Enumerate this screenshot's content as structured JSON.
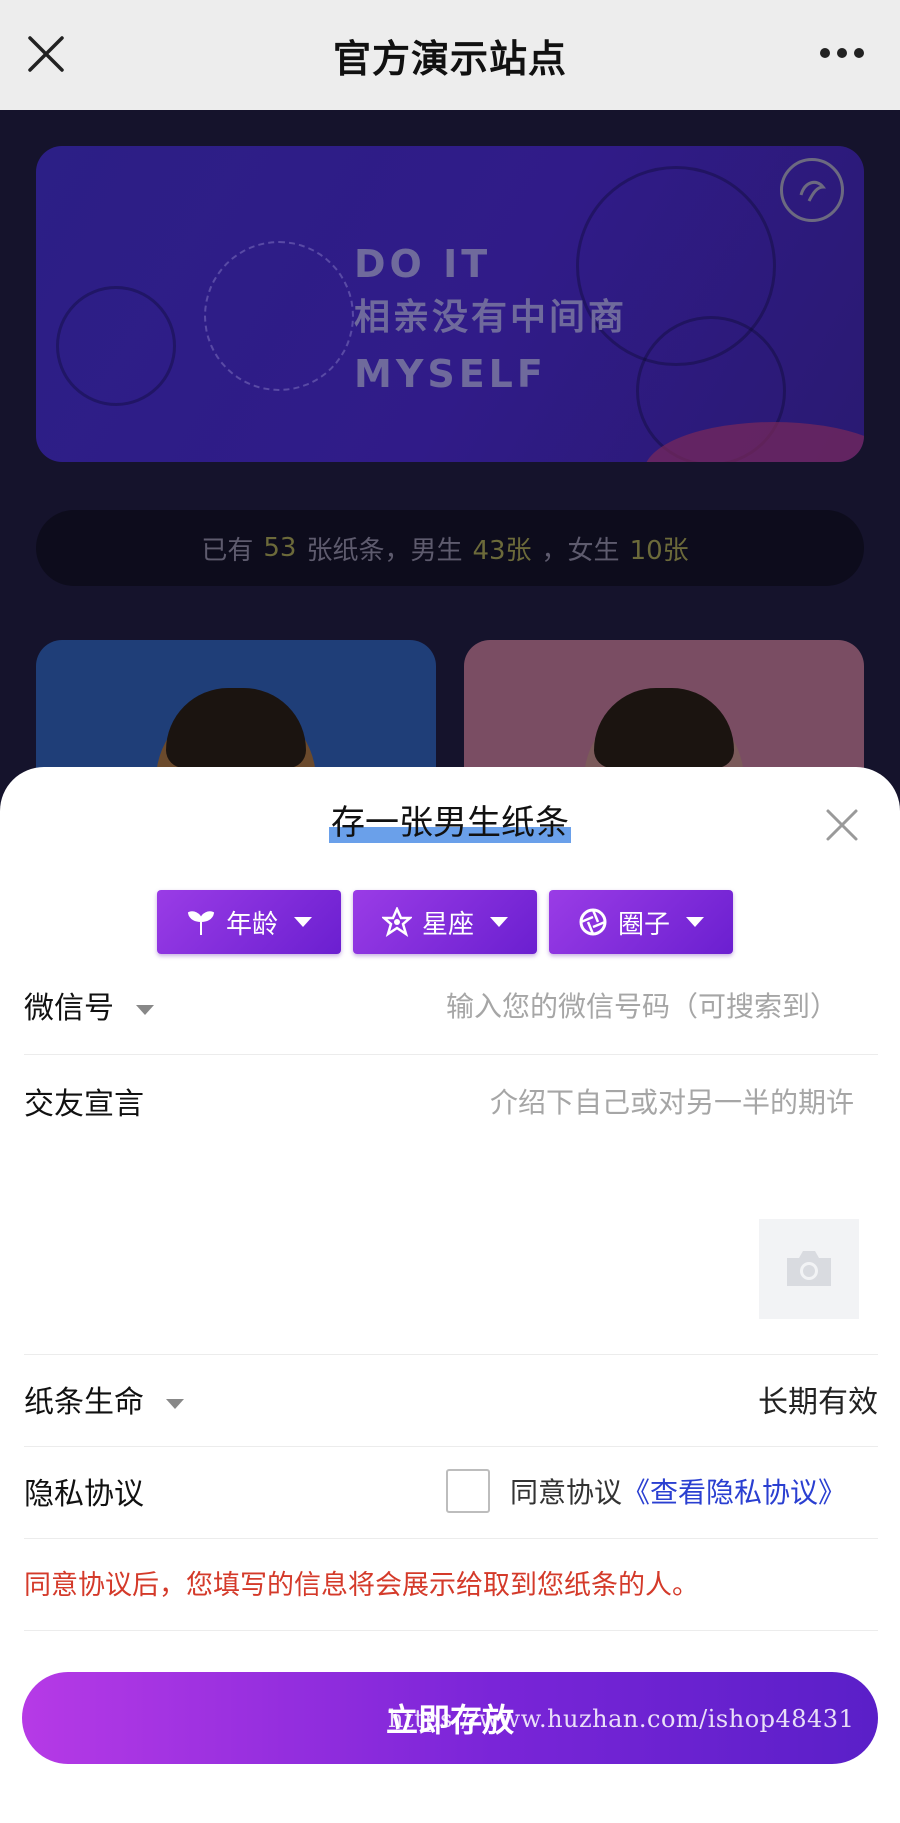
{
  "window": {
    "title": "官方演示站点"
  },
  "banner": {
    "line1": "DO IT",
    "line2": "相亲没有中间商",
    "line3": "MYSELF"
  },
  "stats": {
    "prefix": "已有",
    "total": "53",
    "mid1": "张纸条，男生",
    "male": "43张",
    "mid2": "，女生",
    "female": "10张"
  },
  "sheet": {
    "title": "存一张男生纸条",
    "filters": [
      {
        "label": "年龄",
        "icon": "sprout-icon"
      },
      {
        "label": "星座",
        "icon": "star-icon"
      },
      {
        "label": "圈子",
        "icon": "aperture-icon"
      }
    ],
    "wechat": {
      "label": "微信号",
      "placeholder": "输入您的微信号码（可搜索到）"
    },
    "manifesto": {
      "label": "交友宣言",
      "placeholder": "介绍下自己或对另一半的期许"
    },
    "lifetime": {
      "label": "纸条生命",
      "value": "长期有效"
    },
    "privacy": {
      "label": "隐私协议",
      "agree": "同意协议",
      "link": "《查看隐私协议》",
      "checked": false
    },
    "warning": "同意协议后，您填写的信息将会展示给取到您纸条的人。",
    "submit": "立即存放",
    "watermark": "https://www.huzhan.com/ishop48431"
  }
}
